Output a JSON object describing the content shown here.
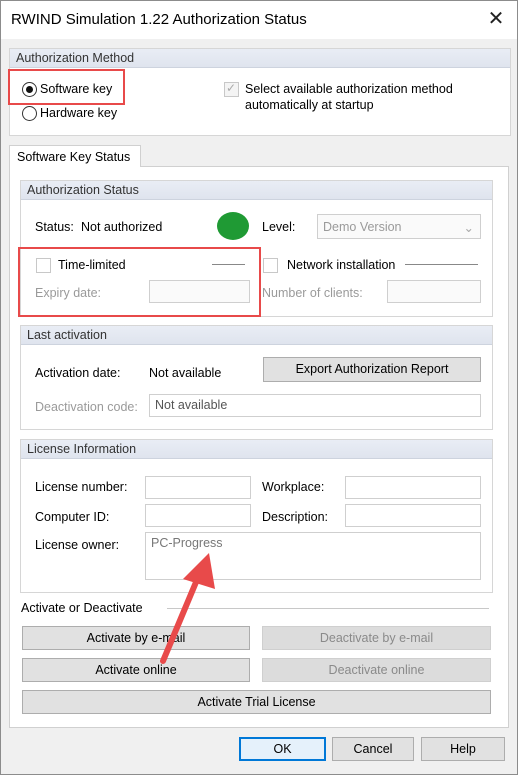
{
  "window": {
    "title": "RWIND Simulation 1.22 Authorization Status",
    "close_glyph": "✕"
  },
  "auth_method": {
    "header": "Authorization Method",
    "software_key": "Software key",
    "hardware_key": "Hardware key",
    "auto_select_line1": "Select available authorization method",
    "auto_select_line2": "automatically at startup"
  },
  "tab": {
    "label": "Software Key Status"
  },
  "auth_status": {
    "header": "Authorization Status",
    "status_label": "Status:",
    "status_value": "Not authorized",
    "status_color": "#1f9a34",
    "level_label": "Level:",
    "level_value": "Demo Version",
    "time_limited": "Time-limited",
    "expiry_label": "Expiry date:",
    "network_installation": "Network installation",
    "clients_label": "Number of clients:"
  },
  "last_activation": {
    "header": "Last activation",
    "activation_date_label": "Activation date:",
    "activation_date_value": "Not available",
    "export_button": "Export Authorization Report",
    "deactivation_code_label": "Deactivation code:",
    "deactivation_code_value": "Not available"
  },
  "license_info": {
    "header": "License Information",
    "license_number_label": "License number:",
    "workplace_label": "Workplace:",
    "computer_id_label": "Computer ID:",
    "description_label": "Description:",
    "license_owner_label": "License owner:",
    "license_owner_value": "PC-Progress"
  },
  "activate": {
    "header": "Activate or Deactivate",
    "by_email": "Activate by e-mail",
    "deactivate_email": "Deactivate by e-mail",
    "online": "Activate online",
    "deactivate_online": "Deactivate online",
    "trial": "Activate Trial License"
  },
  "footer": {
    "ok": "OK",
    "cancel": "Cancel",
    "help": "Help"
  },
  "annotation_color": "#e84a4a"
}
